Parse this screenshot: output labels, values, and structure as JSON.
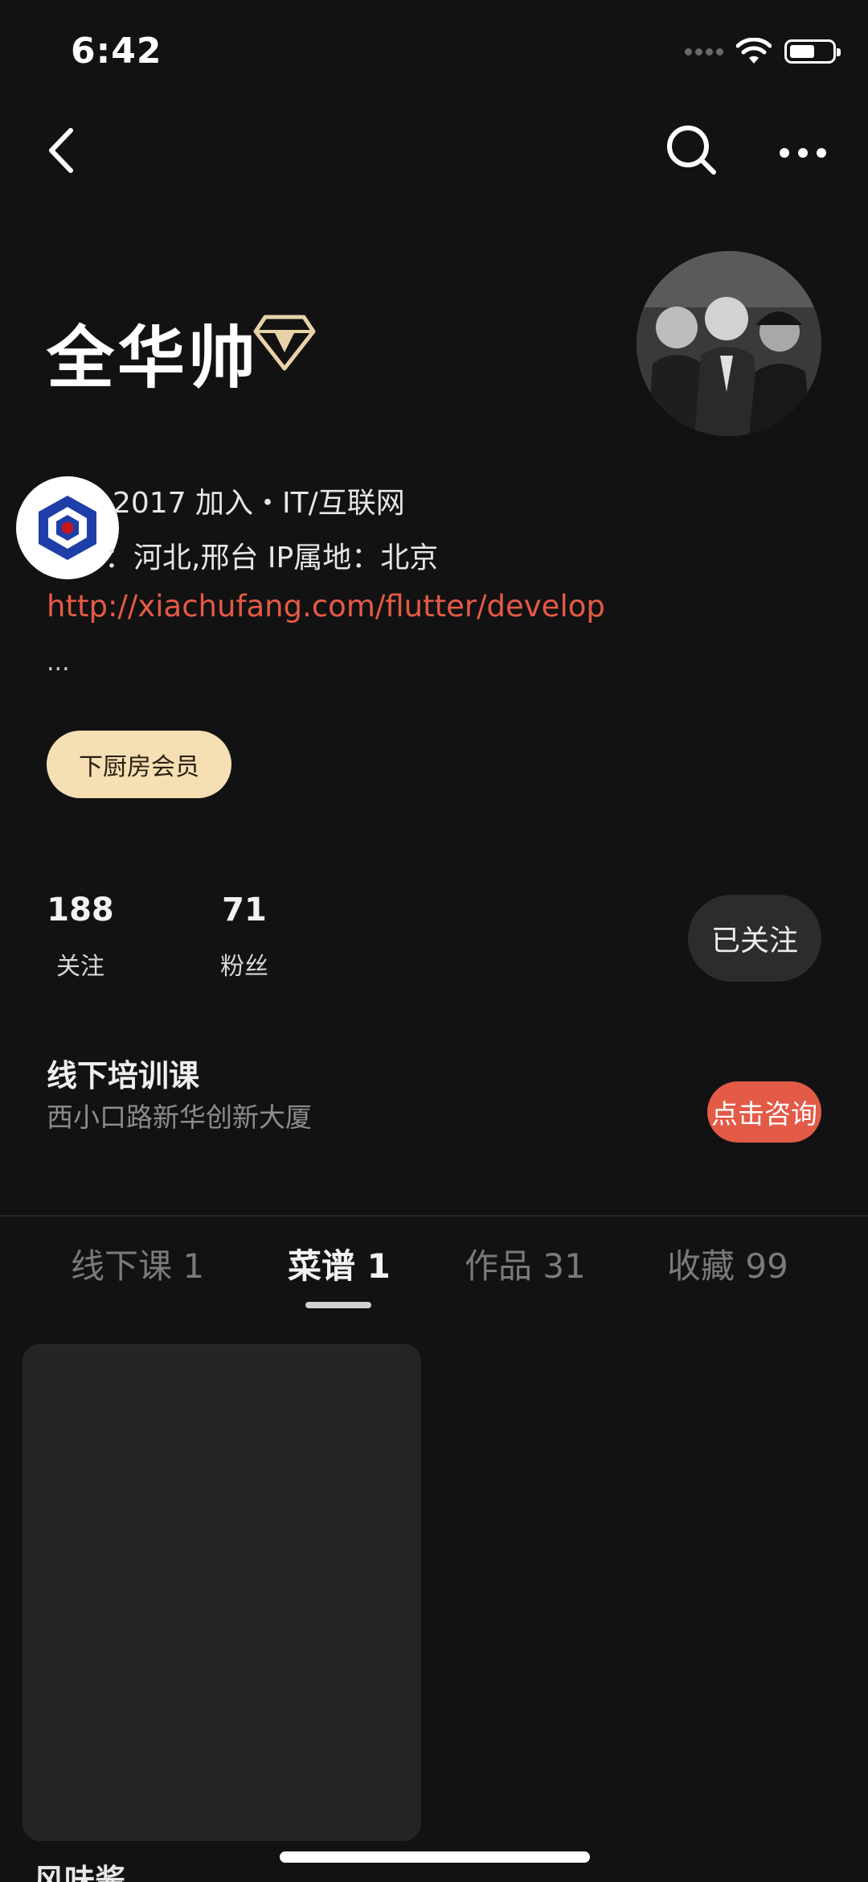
{
  "status_bar": {
    "time": "6:42",
    "icons": [
      "cellular-signal-icon",
      "wifi-icon",
      "battery-icon"
    ]
  },
  "nav": {
    "back_icon": "chevron-left-icon",
    "search_icon": "search-icon",
    "more_icon": "more-horizontal-icon"
  },
  "profile": {
    "name": "全华帅",
    "badge_icon": "diamond-icon",
    "join_info": "2017 加入・IT/互联网",
    "location_info": "：河北,邢台  IP属地：北京",
    "link": "http://xiachufang.com/flutter/develop",
    "ellipsis": "...",
    "member_label": "下厨房会员"
  },
  "stats": {
    "following_count": "188",
    "following_label": "关注",
    "fans_count": "71",
    "fans_label": "粉丝",
    "follow_button": "已关注"
  },
  "course": {
    "title": "线下培训课",
    "address": "西小口路新华创新大厦",
    "consult_button": "点击咨询"
  },
  "tabs": [
    {
      "label": "线下课 1",
      "active": false
    },
    {
      "label": "菜谱 1",
      "active": true
    },
    {
      "label": "作品 31",
      "active": false
    },
    {
      "label": "收藏 99",
      "active": false
    }
  ],
  "recipes": [
    {
      "title": "风味酱"
    }
  ],
  "colors": {
    "background": "#121212",
    "link": "#e65a45",
    "consult": "#e35a47",
    "member_pill": "#f5dfb3"
  }
}
